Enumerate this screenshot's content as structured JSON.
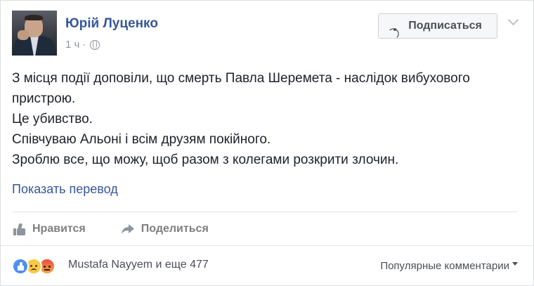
{
  "author": {
    "name": "Юрій Луценко",
    "timestamp": "1 ч",
    "separator": "·",
    "privacy_icon": "globe-icon"
  },
  "follow_button": {
    "label": "Подписаться",
    "icon": "rss-icon"
  },
  "menu_icon": "chevron-down-icon",
  "post": {
    "lines": [
      "З місця події доповіли, що смерть Павла Шеремета - наслідок вибухового пристрою.",
      "Це убивство.",
      "Співчуваю Альоні і всім друзям покійного.",
      "Зроблю все, що можу, щоб разом з колегами розкрити злочин."
    ]
  },
  "translate_link": "Показать перевод",
  "actions": {
    "like_label": "Нравится",
    "share_label": "Поделиться"
  },
  "footer": {
    "reactions": [
      "like",
      "sad",
      "angry"
    ],
    "reactions_text": "Mustafa Nayyem и еще 477",
    "sort_label": "Популярные комментарии"
  },
  "colors": {
    "link": "#365899",
    "text": "#1d2129",
    "muted": "#90949c",
    "action": "#7f7f7f"
  }
}
